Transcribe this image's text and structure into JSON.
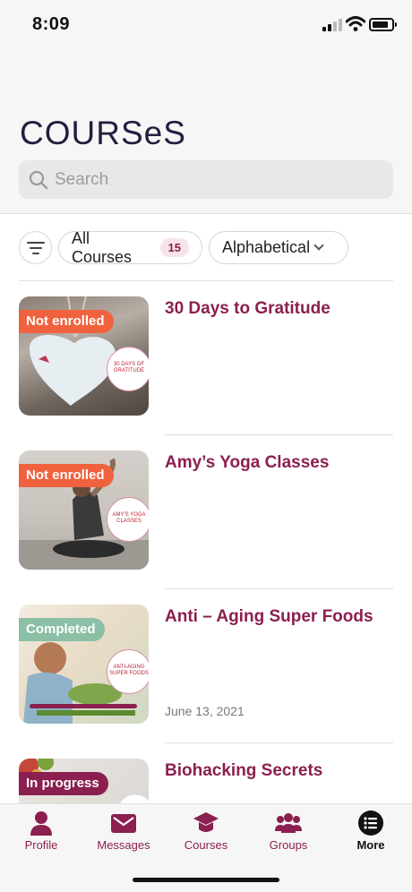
{
  "status_bar": {
    "time": "8:09"
  },
  "header": {
    "title": "COURSeS",
    "search": {
      "placeholder": "Search",
      "value": ""
    }
  },
  "filters": {
    "all_label": "All Courses",
    "all_count": "15",
    "sort_label": "Alphabetical"
  },
  "courses": [
    {
      "title": "30 Days to Gratitude",
      "badge": "Not enrolled",
      "date": "",
      "logo_text": "30 DAYS OF GRATITUDE"
    },
    {
      "title": "Amy’s Yoga Classes",
      "badge": "Not enrolled",
      "date": "",
      "logo_text": "AMY'S YOGA CLASSES"
    },
    {
      "title": "Anti – Aging Super Foods",
      "badge": "Completed",
      "date": "June 13, 2021",
      "logo_text": "ANTI-AGING SUPER FOODS"
    },
    {
      "title": "Biohacking Secrets",
      "badge": "In progress",
      "date": ""
    }
  ],
  "tabbar": {
    "items": [
      {
        "label": "Profile",
        "icon": "person-icon"
      },
      {
        "label": "Messages",
        "icon": "envelope-icon"
      },
      {
        "label": "Courses",
        "icon": "graduation-cap-icon"
      },
      {
        "label": "Groups",
        "icon": "group-icon"
      },
      {
        "label": "More",
        "icon": "list-icon"
      }
    ]
  },
  "colors": {
    "accent": "#8b1f4f",
    "not_enrolled": "#f0623e",
    "completed": "#8bbfa6",
    "title": "#221f3f"
  }
}
